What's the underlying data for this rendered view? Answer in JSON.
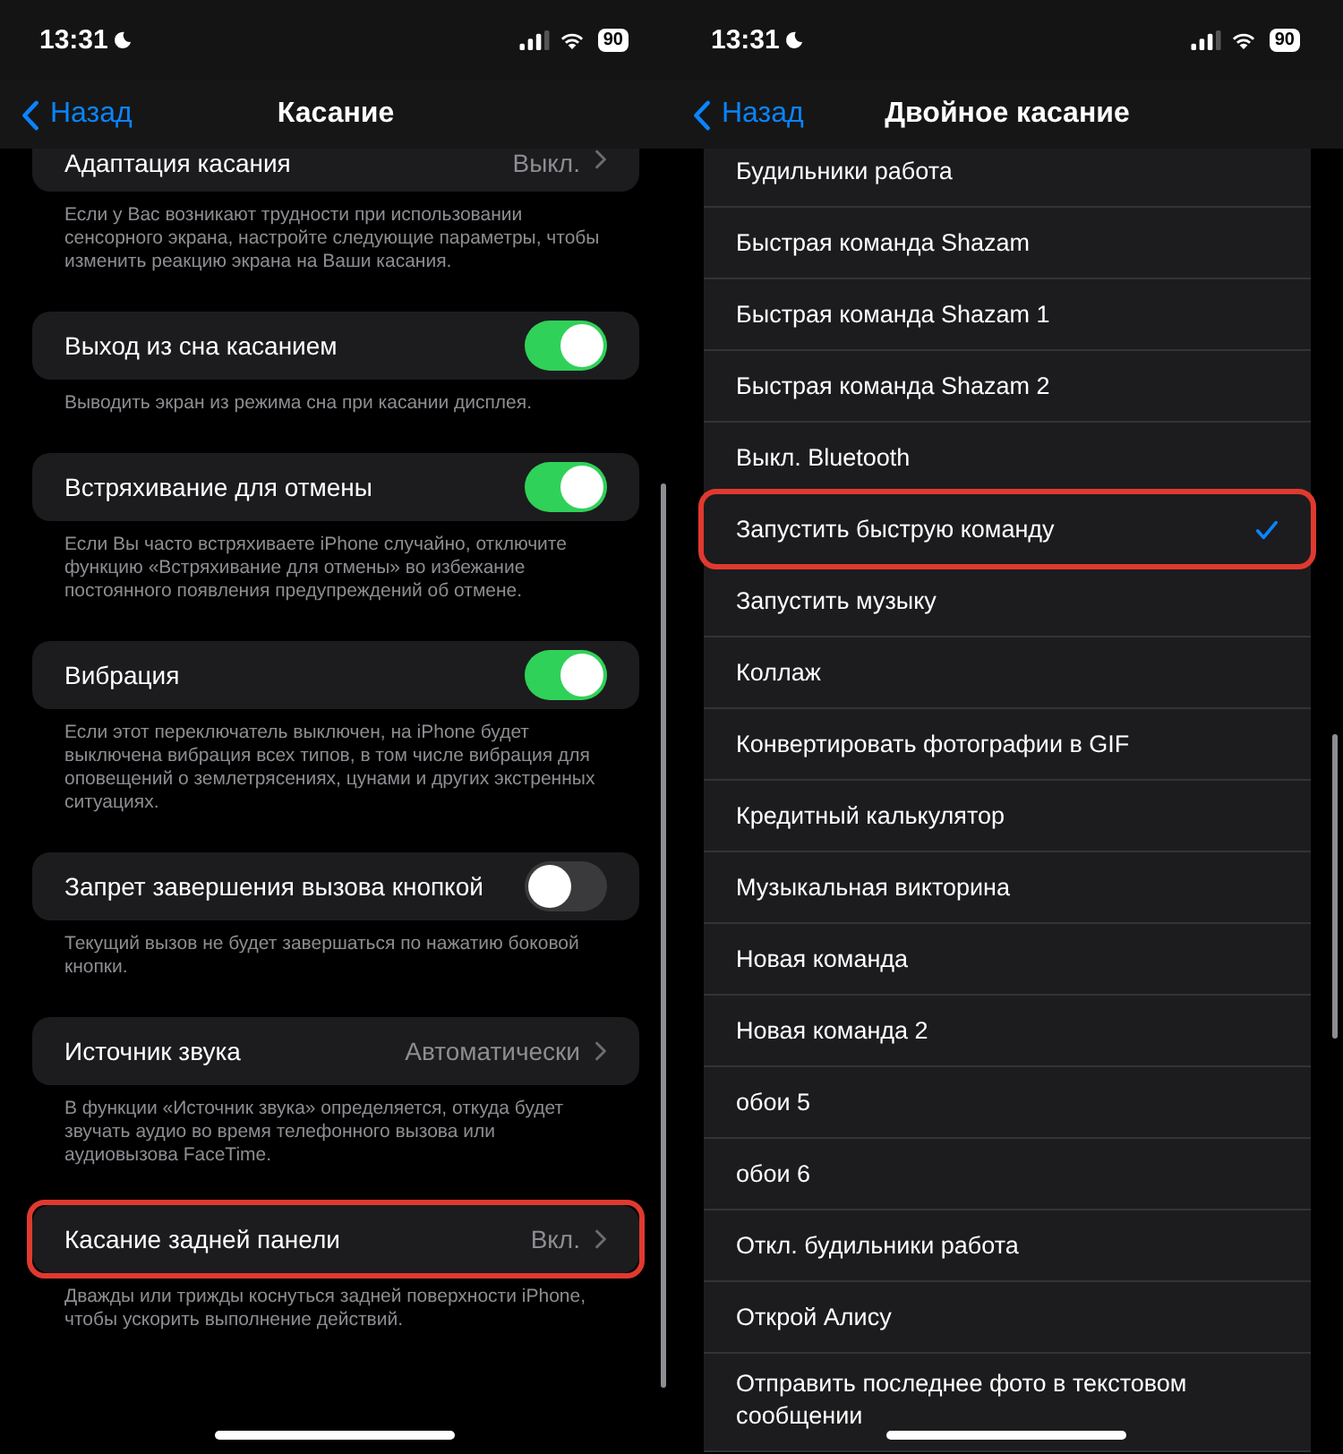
{
  "left_screen": {
    "status_bar": {
      "time": "13:31",
      "battery": "90"
    },
    "nav": {
      "back": "Назад",
      "title": "Касание"
    },
    "groups": [
      {
        "row": {
          "kind": "value",
          "label": "Адаптация касания",
          "value": "Выкл.",
          "highlighted": false
        },
        "footer": "Если у Вас возникают трудности при использовании сенсорного экрана, настройте следующие параметры, чтобы изменить реакцию экрана на Ваши касания."
      },
      {
        "row": {
          "kind": "toggle",
          "label": "Выход из сна касанием",
          "on": true,
          "highlighted": false
        },
        "footer": "Выводить экран из режима сна при касании дисплея."
      },
      {
        "row": {
          "kind": "toggle",
          "label": "Встряхивание для отмены",
          "on": true,
          "highlighted": false
        },
        "footer": "Если Вы часто встряхиваете iPhone случайно, отключите функцию «Встряхивание для отмены» во избежание постоянного появления предупреждений об отмене."
      },
      {
        "row": {
          "kind": "toggle",
          "label": "Вибрация",
          "on": true,
          "highlighted": false
        },
        "footer": "Если этот переключатель выключен, на iPhone будет выключена вибрация всех типов, в том числе вибрация для оповещений о землетрясениях, цунами и других экстренных ситуациях."
      },
      {
        "row": {
          "kind": "toggle",
          "label": "Запрет завершения вызова кнопкой",
          "on": false,
          "highlighted": false
        },
        "footer": "Текущий вызов не будет завершаться по нажатию боковой кнопки."
      },
      {
        "row": {
          "kind": "value",
          "label": "Источник звука",
          "value": "Автоматически",
          "highlighted": false
        },
        "footer": "В функции «Источник звука» определяется, откуда будет звучать аудио во время телефонного вызова или аудиовызова FaceTime."
      },
      {
        "row": {
          "kind": "value",
          "label": "Касание задней панели",
          "value": "Вкл.",
          "highlighted": true
        },
        "footer": "Дважды или трижды коснуться задней поверхности iPhone, чтобы ускорить выполнение действий."
      }
    ]
  },
  "right_screen": {
    "status_bar": {
      "time": "13:31",
      "battery": "90"
    },
    "nav": {
      "back": "Назад",
      "title": "Двойное касание"
    },
    "options": [
      {
        "label": "Будильники работа",
        "selected": false,
        "highlighted": false
      },
      {
        "label": "Быстрая команда Shazam",
        "selected": false,
        "highlighted": false
      },
      {
        "label": "Быстрая команда Shazam 1",
        "selected": false,
        "highlighted": false
      },
      {
        "label": "Быстрая команда Shazam 2",
        "selected": false,
        "highlighted": false
      },
      {
        "label": "Выкл. Bluetooth",
        "selected": false,
        "highlighted": false
      },
      {
        "label": "Запустить быструю команду",
        "selected": true,
        "highlighted": true
      },
      {
        "label": "Запустить музыку",
        "selected": false,
        "highlighted": false
      },
      {
        "label": "Коллаж",
        "selected": false,
        "highlighted": false
      },
      {
        "label": "Конвертировать фотографии в GIF",
        "selected": false,
        "highlighted": false
      },
      {
        "label": "Кредитный калькулятор",
        "selected": false,
        "highlighted": false
      },
      {
        "label": "Музыкальная викторина",
        "selected": false,
        "highlighted": false
      },
      {
        "label": "Новая команда",
        "selected": false,
        "highlighted": false
      },
      {
        "label": "Новая команда 2",
        "selected": false,
        "highlighted": false
      },
      {
        "label": "обои 5",
        "selected": false,
        "highlighted": false
      },
      {
        "label": "обои 6",
        "selected": false,
        "highlighted": false
      },
      {
        "label": "Откл. будильники работа",
        "selected": false,
        "highlighted": false
      },
      {
        "label": "Открой Алису",
        "selected": false,
        "highlighted": false
      },
      {
        "label": "Отправить последнее фото в текстовом сообщении",
        "selected": false,
        "highlighted": false
      }
    ]
  }
}
